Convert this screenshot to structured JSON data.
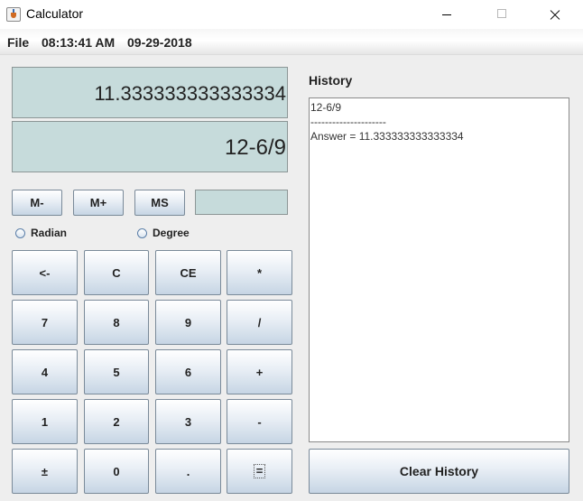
{
  "window": {
    "title": "Calculator",
    "icons": {
      "app": "java-cup-icon",
      "minimize": "minimize-icon",
      "maximize": "maximize-icon",
      "close": "close-icon"
    }
  },
  "menubar": {
    "file": "File",
    "time": "08:13:41 AM",
    "date": "09-29-2018"
  },
  "display": {
    "result": "11.333333333333334",
    "expression": "12-6/9",
    "memory": ""
  },
  "memory_buttons": [
    "M-",
    "M+",
    "MS"
  ],
  "mode": {
    "radian": "Radian",
    "degree": "Degree",
    "selected": ""
  },
  "keypad": {
    "rows": [
      [
        "<-",
        "C",
        "CE",
        "*"
      ],
      [
        "7",
        "8",
        "9",
        "/"
      ],
      [
        "4",
        "5",
        "6",
        "+"
      ],
      [
        "1",
        "2",
        "3",
        "-"
      ],
      [
        "±",
        "0",
        ".",
        "="
      ]
    ]
  },
  "history": {
    "label": "History",
    "lines": [
      "12-6/9",
      "---------------------",
      "Answer = 11.333333333333334"
    ],
    "clear_label": "Clear History"
  },
  "colors": {
    "display_bg": "#c6dbdb",
    "window_bg": "#eeeeee",
    "button_gradient_bottom": "#c6d5e4"
  }
}
